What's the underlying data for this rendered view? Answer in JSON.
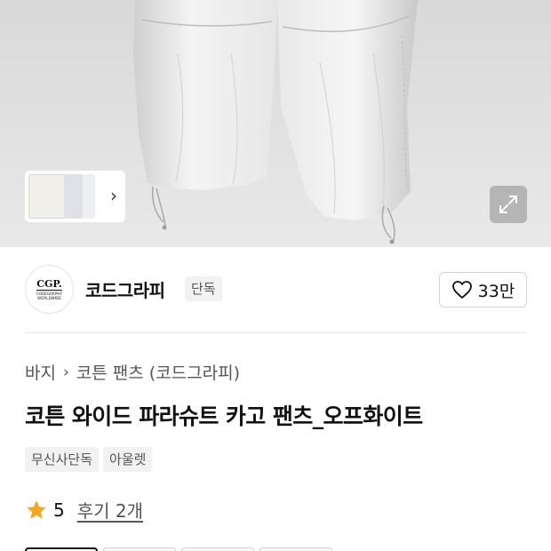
{
  "gallery": {
    "thumbnail_next_icon": "chevron-right-icon",
    "expand_icon": "expand-arrows-icon"
  },
  "brand": {
    "logo_text": "CGP.",
    "logo_subtext": "CODEGRAPHY WORLDWIDE",
    "name": "코드그라피",
    "badge": "단독",
    "like_icon": "heart-outline-icon",
    "like_count": "33만"
  },
  "breadcrumb": {
    "category": "바지",
    "separator_icon": "chevron-right-icon",
    "subcategory": "코튼 팬츠 (코드그라피)"
  },
  "product": {
    "title": "코튼 와이드 파라슈트 카고 팬츠_오프화이트",
    "tags": [
      "무신사단독",
      "아울렛"
    ]
  },
  "rating": {
    "star_icon": "star-icon",
    "star_color": "#f5a623",
    "value": "5",
    "review_label": "후기 2개"
  }
}
